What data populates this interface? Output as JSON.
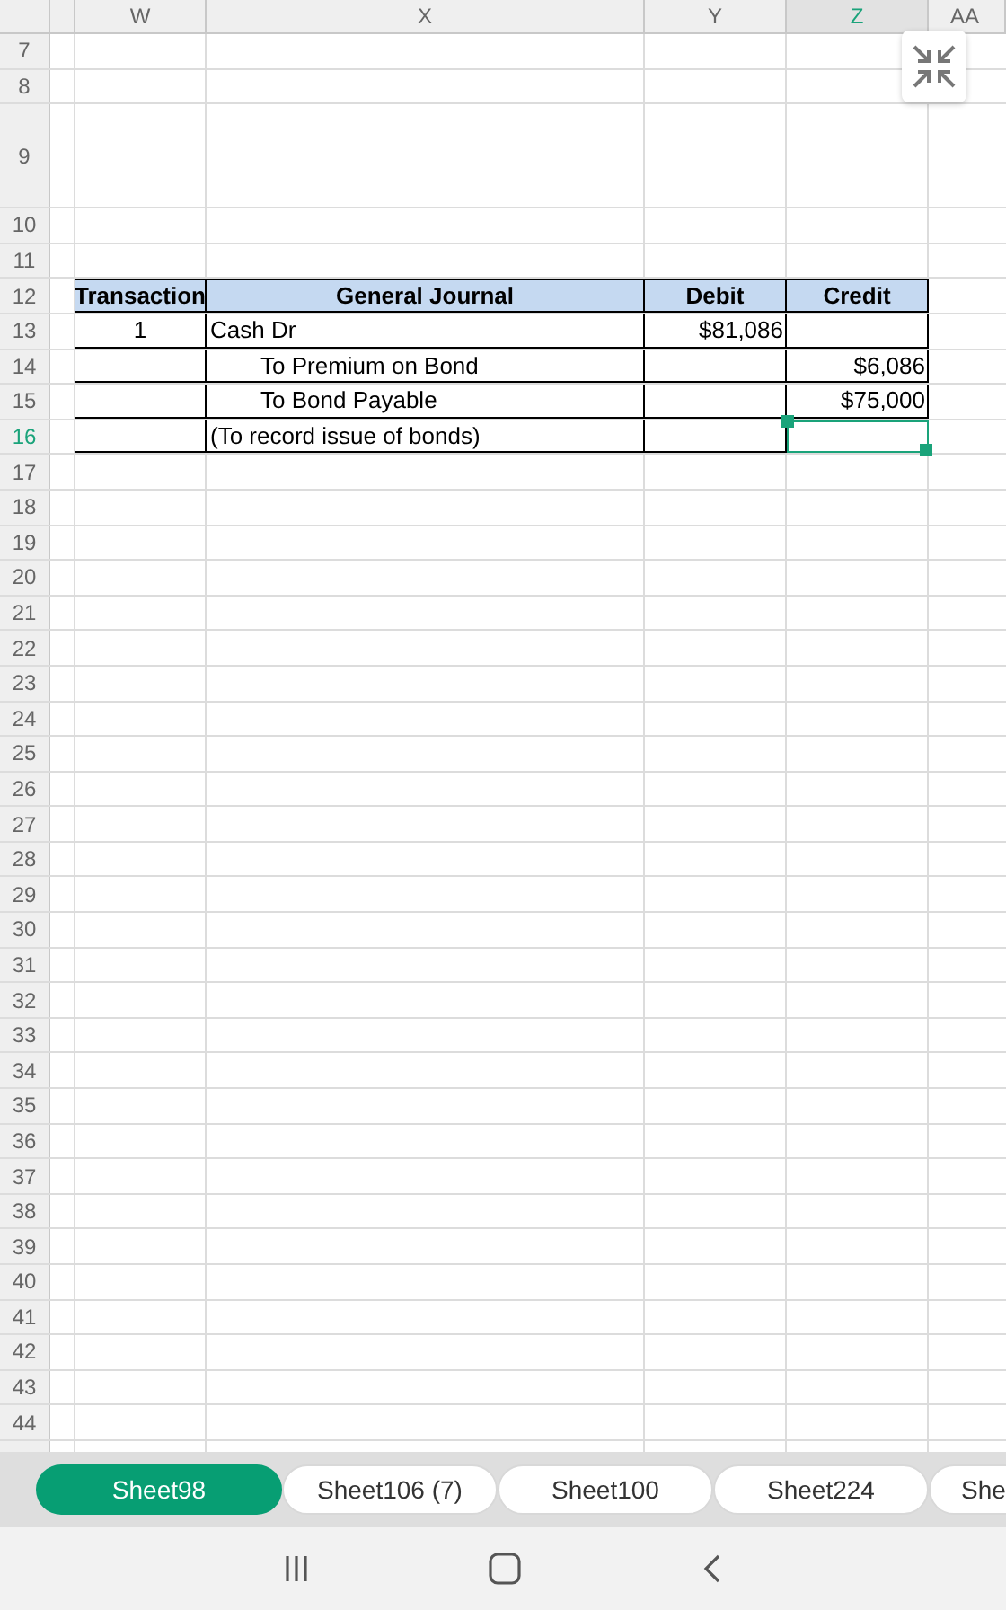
{
  "columns": [
    {
      "selected": false
    },
    {
      "label": "W",
      "selected": false
    },
    {
      "label": "X",
      "selected": false
    },
    {
      "label": "Y",
      "selected": false
    },
    {
      "label": "Z",
      "selected": true
    },
    {
      "label": "AA",
      "selected": false
    }
  ],
  "rows": [
    {
      "label": "7",
      "selected": false
    },
    {
      "label": "8",
      "selected": false
    },
    {
      "label": "9",
      "selected": false,
      "kind": "tall"
    },
    {
      "label": "10",
      "selected": false
    },
    {
      "label": "11",
      "selected": false
    },
    {
      "label": "12",
      "selected": false,
      "cells": [
        {
          "text": "Transaction",
          "kind": "header",
          "selected": false
        },
        {
          "text": "General Journal",
          "kind": "header",
          "selected": false
        },
        {
          "text": "Debit",
          "kind": "header",
          "selected": false
        },
        {
          "text": "Credit",
          "kind": "header",
          "selected": false
        }
      ]
    },
    {
      "label": "13",
      "selected": false,
      "cells": [
        {
          "text": "1",
          "kind": "center",
          "selected": false
        },
        {
          "text": "Cash Dr",
          "kind": "text",
          "selected": false
        },
        {
          "text": "$81,086",
          "kind": "number",
          "selected": false
        },
        {
          "kind": "blank",
          "selected": false
        }
      ]
    },
    {
      "label": "14",
      "selected": false,
      "cells": [
        {
          "kind": "blank",
          "selected": false
        },
        {
          "text": "To Premium on Bond",
          "kind": "indented",
          "selected": false
        },
        {
          "kind": "blank",
          "selected": false
        },
        {
          "text": "$6,086",
          "kind": "number",
          "selected": false
        }
      ]
    },
    {
      "label": "15",
      "selected": false,
      "cells": [
        {
          "kind": "blank",
          "selected": false
        },
        {
          "text": "To Bond Payable",
          "kind": "indented",
          "selected": false
        },
        {
          "kind": "blank",
          "selected": false
        },
        {
          "text": "$75,000",
          "kind": "number",
          "selected": false
        }
      ]
    },
    {
      "label": "16",
      "selected": true,
      "cells": [
        {
          "kind": "blank",
          "selected": false
        },
        {
          "text": "(To record issue of bonds)",
          "kind": "text",
          "selected": false
        },
        {
          "kind": "blank",
          "selected": false
        },
        {
          "kind": "blank",
          "selected": true
        }
      ]
    },
    {
      "label": "17",
      "selected": false
    },
    {
      "label": "18",
      "selected": false
    },
    {
      "label": "19",
      "selected": false
    },
    {
      "label": "20",
      "selected": false
    },
    {
      "label": "21",
      "selected": false
    },
    {
      "label": "22",
      "selected": false
    },
    {
      "label": "23",
      "selected": false
    },
    {
      "label": "24",
      "selected": false
    },
    {
      "label": "25",
      "selected": false
    },
    {
      "label": "26",
      "selected": false
    },
    {
      "label": "27",
      "selected": false
    },
    {
      "label": "28",
      "selected": false
    },
    {
      "label": "29",
      "selected": false
    },
    {
      "label": "30",
      "selected": false
    },
    {
      "label": "31",
      "selected": false
    },
    {
      "label": "32",
      "selected": false
    },
    {
      "label": "33",
      "selected": false
    },
    {
      "label": "34",
      "selected": false
    },
    {
      "label": "35",
      "selected": false
    },
    {
      "label": "36",
      "selected": false
    },
    {
      "label": "37",
      "selected": false
    },
    {
      "label": "38",
      "selected": false
    },
    {
      "label": "39",
      "selected": false
    },
    {
      "label": "40",
      "selected": false
    },
    {
      "label": "41",
      "selected": false
    },
    {
      "label": "42",
      "selected": false
    },
    {
      "label": "43",
      "selected": false
    },
    {
      "label": "44",
      "selected": false
    },
    {
      "kind": "partial"
    }
  ],
  "sheet_tabs": [
    {
      "label": "Sheet98",
      "selected": true
    },
    {
      "label": "Sheet106 (7)",
      "selected": false
    },
    {
      "label": "Sheet100",
      "selected": false
    },
    {
      "label": "Sheet224",
      "selected": false
    },
    {
      "label": "She",
      "selected": false
    }
  ]
}
